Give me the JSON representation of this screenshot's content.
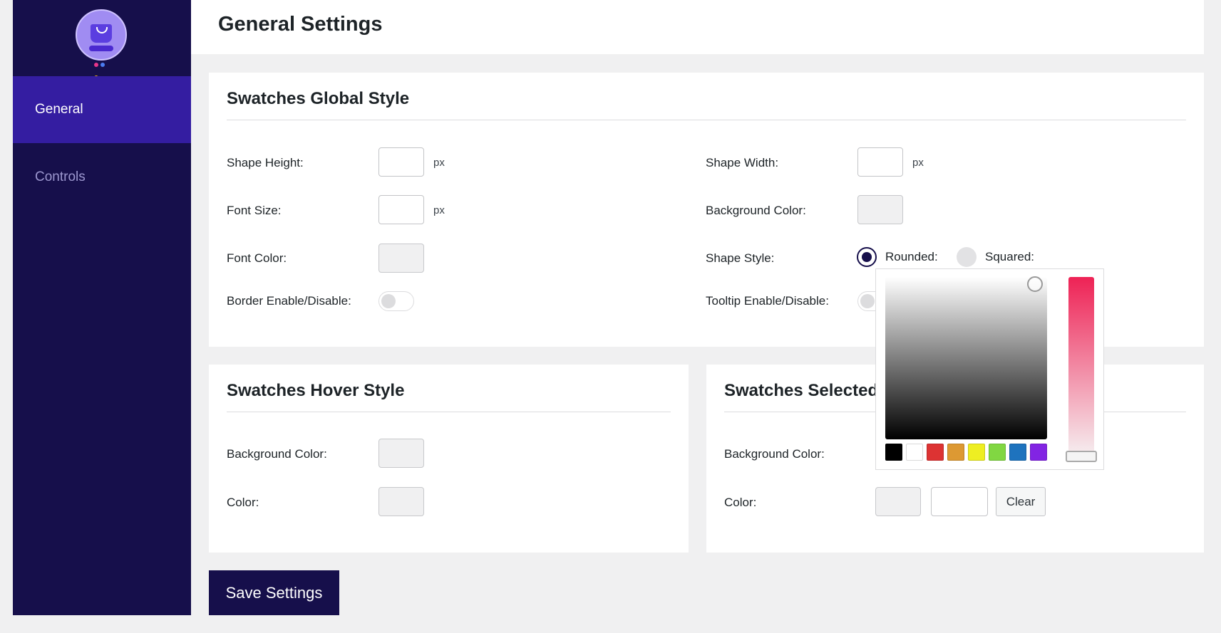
{
  "sidebar": {
    "items": [
      {
        "label": "General",
        "active": true
      },
      {
        "label": "Controls",
        "active": false
      }
    ]
  },
  "header": {
    "title": "General Settings"
  },
  "global_style": {
    "title": "Swatches Global Style",
    "shape_height_label": "Shape Height:",
    "shape_width_label": "Shape Width:",
    "font_size_label": "Font Size:",
    "background_color_label": "Background Color:",
    "font_color_label": "Font Color:",
    "shape_style_label": "Shape Style:",
    "border_label": "Border Enable/Disable:",
    "tooltip_label": "Tooltip Enable/Disable:",
    "unit_px": "px",
    "rounded_label": "Rounded:",
    "squared_label": "Squared:",
    "shape_style_value": "Rounded"
  },
  "hover_style": {
    "title": "Swatches Hover Style",
    "background_color_label": "Background Color:",
    "color_label": "Color:"
  },
  "selected_style": {
    "title": "Swatches Selected Style",
    "background_color_label": "Background Color:",
    "color_label": "Color:",
    "clear_label": "Clear"
  },
  "color_picker": {
    "palette": [
      "#000000",
      "#ffffff",
      "#dd3333",
      "#dd9933",
      "#eeee22",
      "#81d742",
      "#1e73be",
      "#8224e3"
    ],
    "hue_color": "#ee2255"
  },
  "save_label": "Save Settings",
  "colors": {
    "sidebar_bg": "#160f4b",
    "sidebar_active": "#341da1",
    "page_bg": "#f0f0f1"
  }
}
